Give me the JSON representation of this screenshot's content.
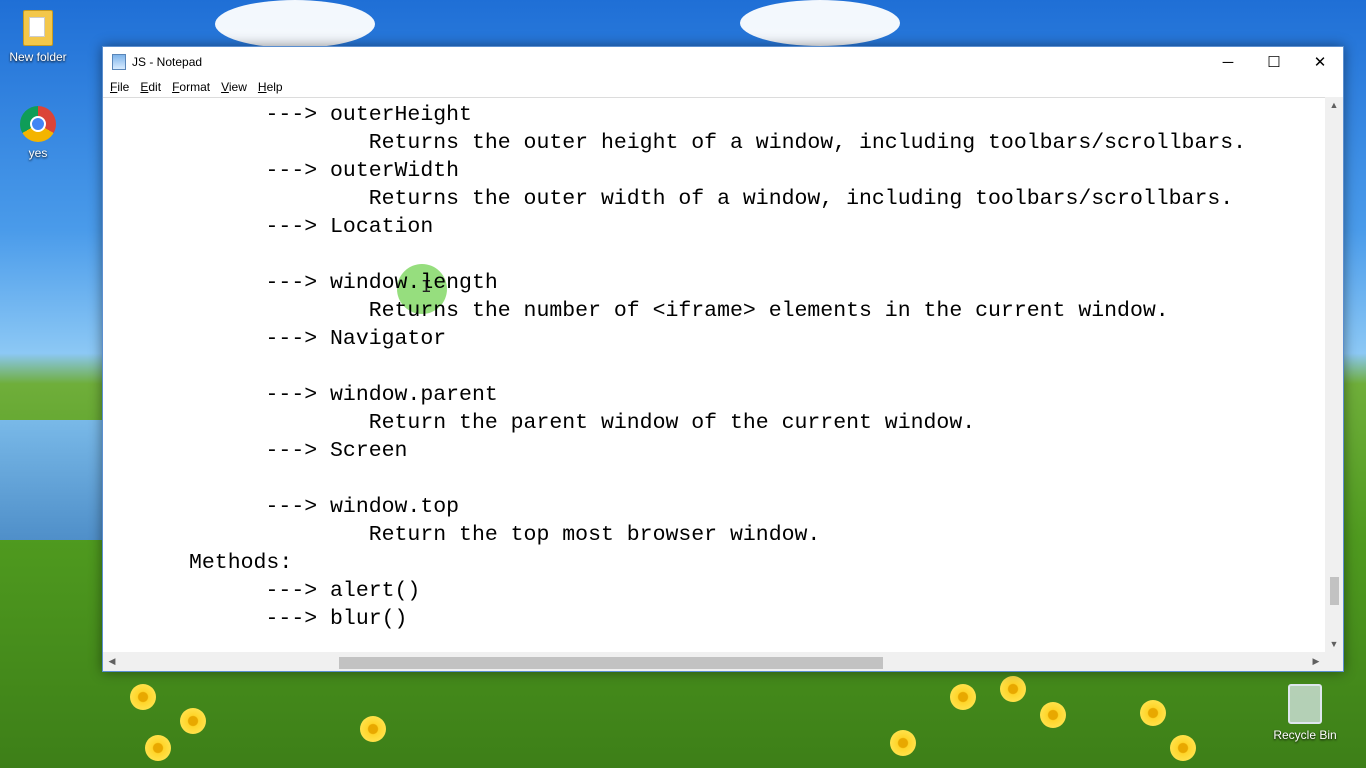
{
  "desktop": {
    "icons": [
      {
        "label": "New folder",
        "icon": "folder-icon"
      },
      {
        "label": "yes",
        "icon": "chrome-icon"
      },
      {
        "label": "Recycle Bin",
        "icon": "recycle-bin-icon"
      }
    ]
  },
  "window": {
    "title": "JS - Notepad",
    "controls": {
      "minimize": "─",
      "maximize": "☐",
      "close": "✕"
    }
  },
  "menu": [
    {
      "accel": "F",
      "rest": "ile"
    },
    {
      "accel": "E",
      "rest": "dit"
    },
    {
      "accel": "F",
      "rest": "ormat"
    },
    {
      "accel": "V",
      "rest": "iew"
    },
    {
      "accel": "H",
      "rest": "elp"
    }
  ],
  "editor": {
    "lines": [
      "     ---> outerHeight",
      "             Returns the outer height of a window, including toolbars/scrollbars.",
      "     ---> outerWidth",
      "             Returns the outer width of a window, including toolbars/scrollbars.",
      "     ---> Location",
      "",
      "     ---> window.length",
      "             Returns the number of <iframe> elements in the current window.",
      "     ---> Navigator",
      "",
      "     ---> window.parent",
      "             Return the parent window of the current window.",
      "     ---> Screen",
      "",
      "     ---> window.top",
      "             Return the top most browser window.",
      "Methods:",
      "     ---> alert()",
      "     ---> blur()"
    ],
    "line_indents": [
      2,
      2,
      2,
      2,
      2,
      0,
      2,
      2,
      2,
      0,
      2,
      2,
      2,
      0,
      2,
      2,
      0,
      2,
      2
    ]
  },
  "scrollbars": {
    "up": "▲",
    "down": "▼",
    "left": "◀",
    "right": "▶"
  }
}
